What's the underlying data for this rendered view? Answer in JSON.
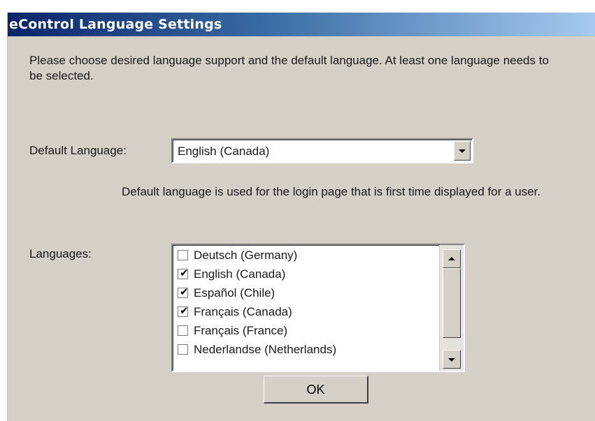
{
  "window": {
    "title": "eControl Language Settings"
  },
  "intro_text": "Please choose desired language support and the default language. At least one language needs to be selected.",
  "default_language": {
    "label": "Default Language:",
    "selected": "English (Canada)"
  },
  "help_text": "Default language is used for the login page that is first time displayed for a user.",
  "languages": {
    "label": "Languages:",
    "items": [
      {
        "label": "Deutsch (Germany)",
        "checked": false
      },
      {
        "label": "English (Canada)",
        "checked": true
      },
      {
        "label": "Español (Chile)",
        "checked": true
      },
      {
        "label": "Français (Canada)",
        "checked": true
      },
      {
        "label": "Français (France)",
        "checked": false
      },
      {
        "label": "Nederlandse (Netherlands)",
        "checked": false
      }
    ]
  },
  "ok_button": {
    "label": "OK"
  },
  "icons": {
    "checkmark": "✔",
    "dropdown": "chevron-down-icon",
    "scroll_up": "scroll-up-icon",
    "scroll_down": "scroll-down-icon"
  }
}
